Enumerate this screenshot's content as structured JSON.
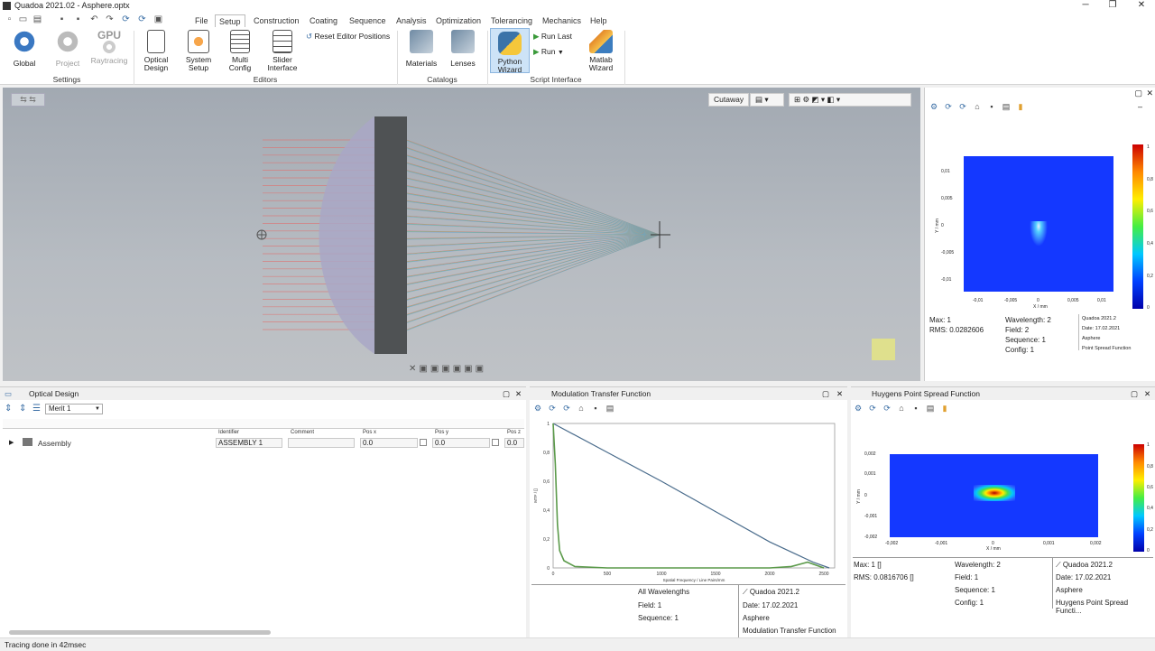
{
  "window": {
    "title": "Quadoa 2021.02 - Asphere.optx"
  },
  "menu": {
    "tabs": [
      "File",
      "Setup",
      "Construction",
      "Coating",
      "Sequence",
      "Analysis",
      "Optimization",
      "Tolerancing",
      "Mechanics",
      "Help"
    ],
    "active": "Setup"
  },
  "ribbon": {
    "settings": {
      "global": "Global",
      "project": "Project",
      "gpu": "GPU",
      "raytracing": "Raytracing",
      "group": "Settings"
    },
    "editors": {
      "optical_line1": "Optical",
      "optical_line2": "Design",
      "system_line1": "System",
      "system_line2": "Setup",
      "multi_line1": "Multi",
      "multi_line2": "Config",
      "slider_line1": "Slider",
      "slider_line2": "Interface",
      "reset": "Reset Editor Positions",
      "group": "Editors"
    },
    "catalogs": {
      "materials": "Materials",
      "lenses": "Lenses",
      "group": "Catalogs"
    },
    "script": {
      "python_line1": "Python",
      "python_line2": "Wizard",
      "run_last": "Run Last",
      "run": "Run",
      "matlab_line1": "Matlab",
      "matlab_line2": "Wizard",
      "group": "Script Interface"
    }
  },
  "viewport": {
    "view_mode": "Cutaway"
  },
  "psf_top": {
    "yticks": [
      "0,01",
      "0,005",
      "0",
      "-0,005",
      "-0,01"
    ],
    "xticks": [
      "-0,01",
      "-0,005",
      "0",
      "0,005",
      "0,01"
    ],
    "xlabel": "X / mm",
    "ylabel": "Y / mm",
    "cbar": [
      "1",
      "0,8",
      "0,6",
      "0,4",
      "0,2",
      "0"
    ],
    "max": "Max: 1",
    "rms": "RMS: 0.0282606",
    "wavelength": "Wavelength: 2",
    "field": "Field: 2",
    "sequence": "Sequence: 1",
    "config": "Config: 1",
    "brand": "Quadoa 2021.2",
    "date": "Date: 17.02.2021",
    "name": "Asphere",
    "type": "Point Spread Function"
  },
  "optical_design": {
    "title": "Optical Design",
    "merit": "Merit 1",
    "cols": {
      "identifier": "Identifier",
      "comment": "Comment",
      "posx": "Pos x",
      "posy": "Pos y",
      "posz": "Pos z"
    },
    "row": {
      "name": "Assembly",
      "identifier": "ASSEMBLY 1",
      "comment": "",
      "posx": "0.0",
      "posy": "0.0",
      "posz": "0.0"
    }
  },
  "mtf": {
    "title": "Modulation Transfer Function",
    "xlabel": "Spatial Frequency / Line Pairs/mm",
    "ylabel": "MTF / []",
    "xticks": [
      "0",
      "500",
      "1000",
      "1500",
      "2000",
      "2500"
    ],
    "yticks": [
      "1",
      "0,8",
      "0,6",
      "0,4",
      "0,2",
      "0"
    ],
    "wavelengths": "All Wavelengths",
    "field": "Field: 1",
    "sequence": "Sequence: 1",
    "brand": "Quadoa 2021.2",
    "date": "Date: 17.02.2021",
    "name": "Asphere",
    "type": "Modulation Transfer Function"
  },
  "chart_data": {
    "type": "line",
    "title": "Modulation Transfer Function",
    "xlabel": "Spatial Frequency / Line Pairs/mm",
    "ylabel": "MTF / []",
    "xlim": [
      0,
      2600
    ],
    "ylim": [
      0,
      1
    ],
    "series": [
      {
        "x": [
          0,
          500,
          1000,
          1500,
          2000,
          2400,
          2550
        ],
        "values": [
          1.0,
          0.8,
          0.6,
          0.39,
          0.18,
          0.04,
          0.0
        ]
      },
      {
        "x": [
          0,
          20,
          40,
          60,
          100,
          200,
          500,
          1000,
          1500,
          2000,
          2200,
          2350,
          2500
        ],
        "values": [
          1.0,
          0.72,
          0.3,
          0.12,
          0.05,
          0.01,
          0.0,
          0.0,
          0.0,
          0.0,
          0.01,
          0.04,
          0.0
        ]
      }
    ]
  },
  "psf_bottom": {
    "title": "Huygens Point Spread Function",
    "yticks": [
      "0,002",
      "0,001",
      "0",
      "-0,001",
      "-0,002"
    ],
    "xticks": [
      "-0,002",
      "-0,001",
      "0",
      "0,001",
      "0,002"
    ],
    "xlabel": "X / mm",
    "ylabel": "Y / mm",
    "cbar": [
      "1",
      "0,8",
      "0,6",
      "0,4",
      "0,2",
      "0"
    ],
    "max": "Max: 1 []",
    "rms": "RMS: 0.0816706 []",
    "wavelength": "Wavelength: 2",
    "field": "Field: 1",
    "sequence": "Sequence: 1",
    "config": "Config: 1",
    "brand": "Quadoa 2021.2",
    "date": "Date: 17.02.2021",
    "name": "Asphere",
    "type": "Huygens Point Spread Functi..."
  },
  "status": {
    "text": "Tracing done in 42msec"
  }
}
